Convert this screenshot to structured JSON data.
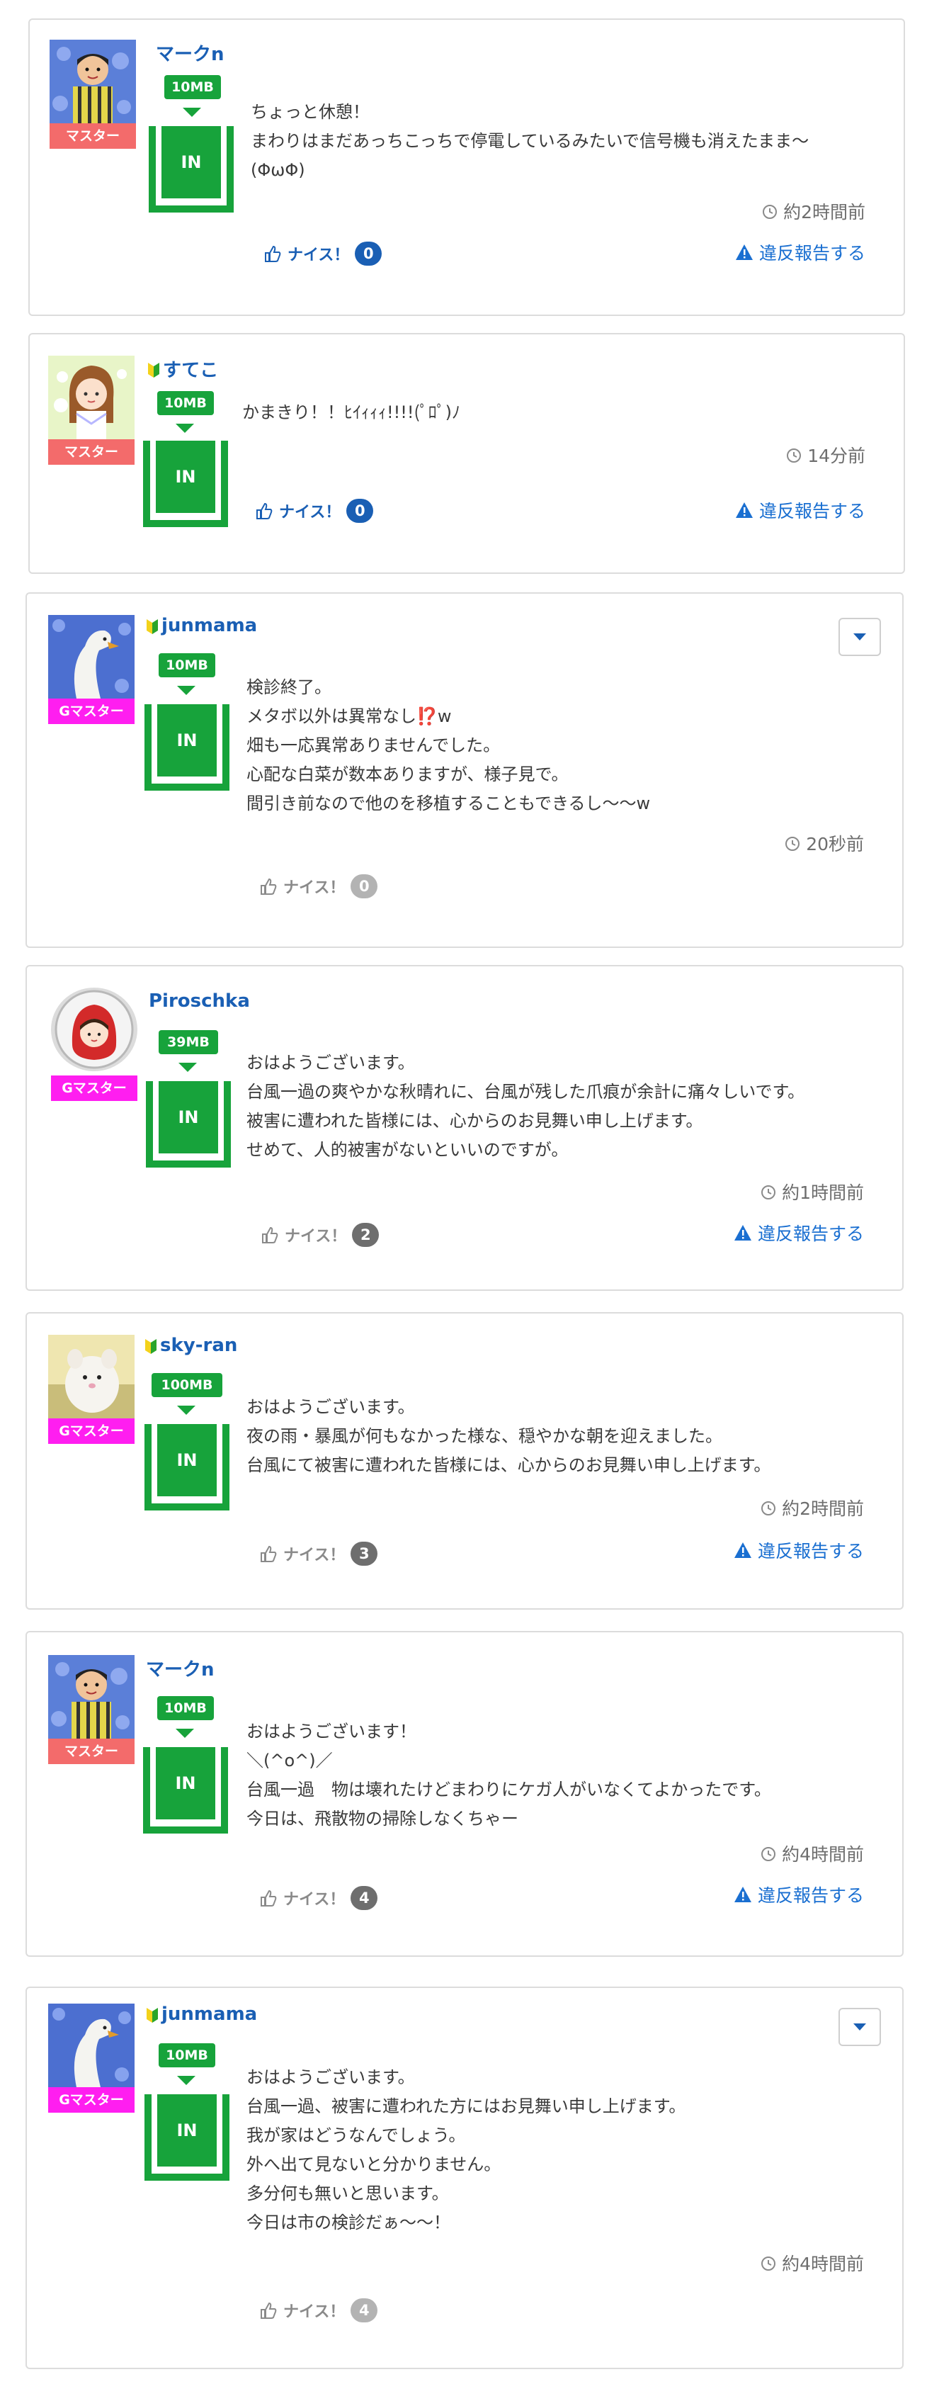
{
  "posts": [
    {
      "username": "マークn",
      "beginner": false,
      "role": "マスター",
      "size": "10MB",
      "in_label": "IN",
      "text": "ちょっと休憩！\nまわりはまだあっちこっちで停電しているみたいで信号機も消えたまま〜\n(ΦωΦ)",
      "time": "約2時間前",
      "like_label": "ナイス！",
      "like_count": "0",
      "report_label": "違反報告する"
    },
    {
      "username": "すてこ",
      "beginner": true,
      "role": "マスター",
      "size": "10MB",
      "in_label": "IN",
      "text": "かまきり！！ﾋｲｨｨｨ!!!!(ﾟﾛﾟ)ﾉ",
      "time": "14分前",
      "like_label": "ナイス！",
      "like_count": "0",
      "report_label": "違反報告する"
    },
    {
      "username": "junmama",
      "beginner": true,
      "role": "Gマスター",
      "size": "10MB",
      "in_label": "IN",
      "text": "検診終了。\nメタボ以外は異常なし⁉️w\n畑も一応異常ありませんでした。\n心配な白菜が数本ありますが、様子見で。\n間引き前なので他のを移植することもできるし〜〜w",
      "time": "20秒前",
      "like_label": "ナイス！",
      "like_count": "0"
    },
    {
      "username": "Piroschka",
      "beginner": false,
      "role": "Gマスター",
      "size": "39MB",
      "in_label": "IN",
      "text": "おはようございます。\n台風一過の爽やかな秋晴れに、台風が残した爪痕が余計に痛々しいです。\n被害に遭われた皆様には、心からのお見舞い申し上げます。\nせめて、人的被害がないといいのですが。",
      "time": "約1時間前",
      "like_label": "ナイス！",
      "like_count": "2",
      "report_label": "違反報告する"
    },
    {
      "username": "sky-ran",
      "beginner": true,
      "role": "Gマスター",
      "size": "100MB",
      "in_label": "IN",
      "text": "おはようございます。\n夜の雨・暴風が何もなかった様な、穏やかな朝を迎えました。\n台風にて被害に遭われた皆様には、心からのお見舞い申し上げます。",
      "time": "約2時間前",
      "like_label": "ナイス！",
      "like_count": "3",
      "report_label": "違反報告する"
    },
    {
      "username": "マークn",
      "beginner": false,
      "role": "マスター",
      "size": "10MB",
      "in_label": "IN",
      "text": "おはようございます！\n＼(^o^)／\n台風一過　物は壊れたけどまわりにケガ人がいなくてよかったです。\n今日は、飛散物の掃除しなくちゃー",
      "time": "約4時間前",
      "like_label": "ナイス！",
      "like_count": "4",
      "report_label": "違反報告する"
    },
    {
      "username": "junmama",
      "beginner": true,
      "role": "Gマスター",
      "size": "10MB",
      "in_label": "IN",
      "text": "おはようございます。\n台風一過、被害に遭われた方にはお見舞い申し上げます。\n我が家はどうなんでしょう。\n外へ出て見ないと分かりません。\n多分何も無いと思います。\n今日は市の検診だぁ〜〜！",
      "time": "約4時間前",
      "like_label": "ナイス！",
      "like_count": "4"
    }
  ],
  "colors": {
    "link_blue": "#1a5fb4",
    "green": "#17a33b",
    "master_red": "#f36b6b",
    "gmaster_magenta": "#ff1ef0"
  },
  "icons": [
    "beginner-mark-icon",
    "clock-icon",
    "thumbs-up-icon",
    "warning-icon",
    "chevron-down-icon"
  ]
}
